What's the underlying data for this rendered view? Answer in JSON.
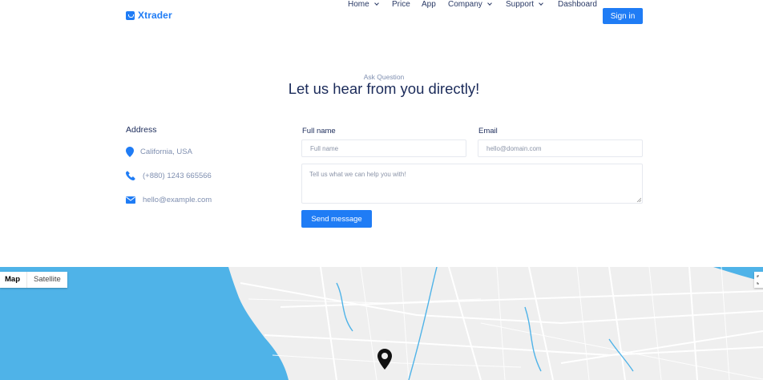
{
  "brand": {
    "name": "Xtrader",
    "color": "#1f7cf5"
  },
  "nav": {
    "items": [
      {
        "label": "Home",
        "dropdown": true
      },
      {
        "label": "Price",
        "dropdown": false
      },
      {
        "label": "App",
        "dropdown": false
      },
      {
        "label": "Company",
        "dropdown": true
      },
      {
        "label": "Support",
        "dropdown": true
      },
      {
        "label": "Dashboard",
        "dropdown": false
      }
    ],
    "signin_label": "Sign in"
  },
  "heading": {
    "eyebrow": "Ask Question",
    "title": "Let us hear from you directly!"
  },
  "address": {
    "title": "Address",
    "location": "California, USA",
    "phone": "(+880) 1243 665566",
    "email": "hello@example.com",
    "icons": [
      "map-pin-icon",
      "phone-icon",
      "envelope-icon"
    ]
  },
  "form": {
    "full_name_label": "Full name",
    "full_name_placeholder": "Full name",
    "email_label": "Email",
    "email_placeholder": "hello@domain.com",
    "message_placeholder": "Tell us what we can help you with!",
    "submit_label": "Send message"
  },
  "map": {
    "type_options": [
      "Map",
      "Satellite"
    ],
    "selected_type": "Map",
    "water_color": "#4fb3e8",
    "land_color": "#efefef"
  }
}
